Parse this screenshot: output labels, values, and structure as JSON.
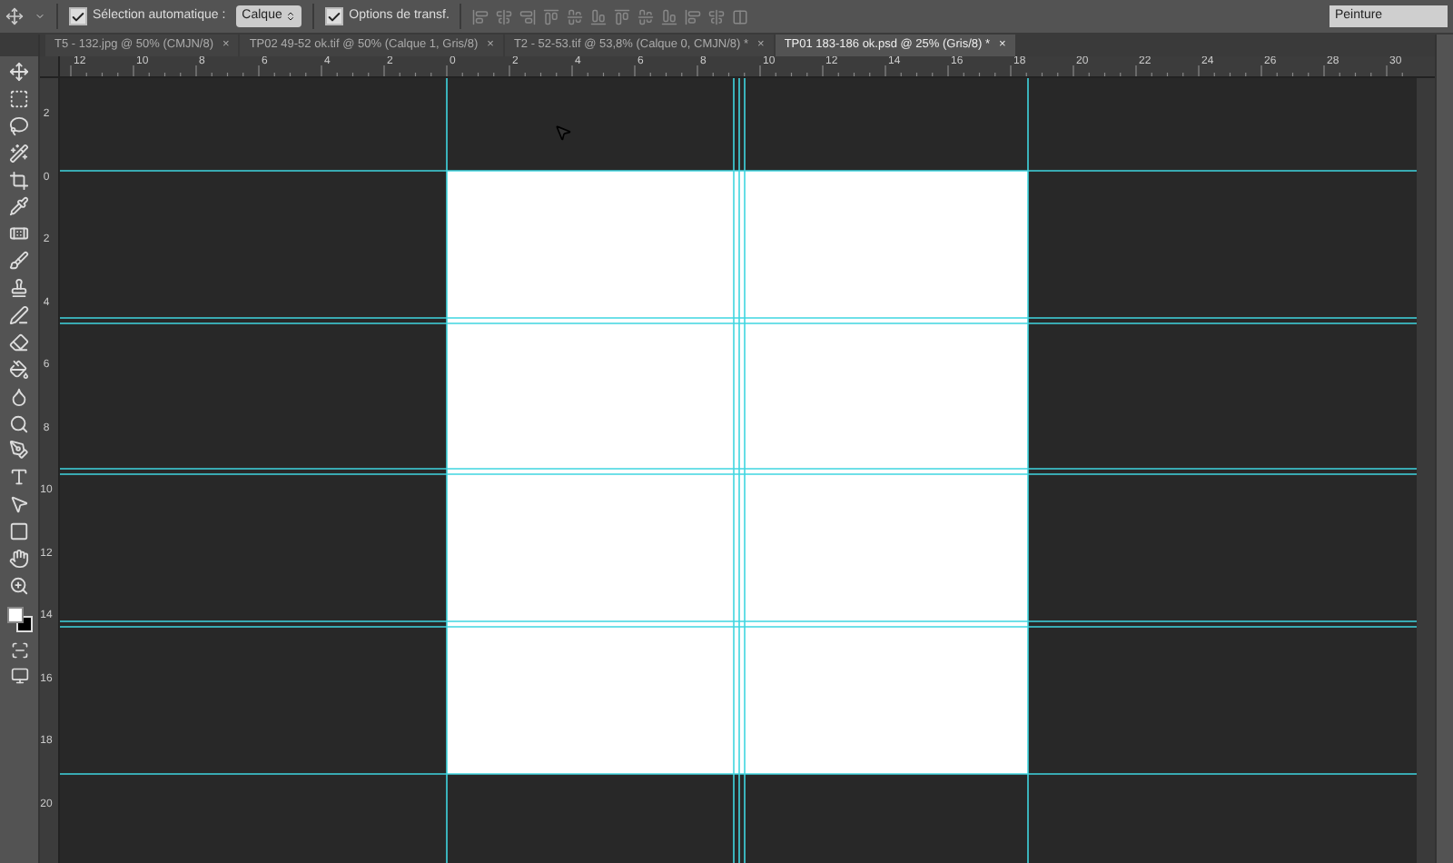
{
  "options_bar": {
    "auto_select": {
      "label": "Sélection automatique :",
      "checked": true
    },
    "auto_select_target": "Calque",
    "transform_controls": {
      "label": "Options de transf.",
      "checked": true
    },
    "workspace": "Peinture"
  },
  "tabs": [
    {
      "label": "T5 - 132.jpg @ 50% (CMJN/8)",
      "close": "×",
      "selected": false
    },
    {
      "label": "TP02 49-52 ok.tif @ 50% (Calque 1, Gris/8)",
      "close": "×",
      "selected": false
    },
    {
      "label": "T2 - 52-53.tif @ 53,8% (Calque 0, CMJN/8) *",
      "close": "×",
      "selected": false
    },
    {
      "label": "TP01 183-186 ok.psd @ 25% (Gris/8) *",
      "close": "×",
      "selected": true
    }
  ],
  "rulers": {
    "horizontal": [
      "12",
      "10",
      "8",
      "6",
      "4",
      "2",
      "0",
      "2",
      "4",
      "6",
      "8",
      "10",
      "12",
      "14",
      "16",
      "18",
      "20",
      "22",
      "24",
      "26",
      "28",
      "30"
    ],
    "vertical": [
      "2",
      "0",
      "2",
      "4",
      "6",
      "8",
      "10",
      "12",
      "14",
      "16",
      "18",
      "20"
    ]
  }
}
